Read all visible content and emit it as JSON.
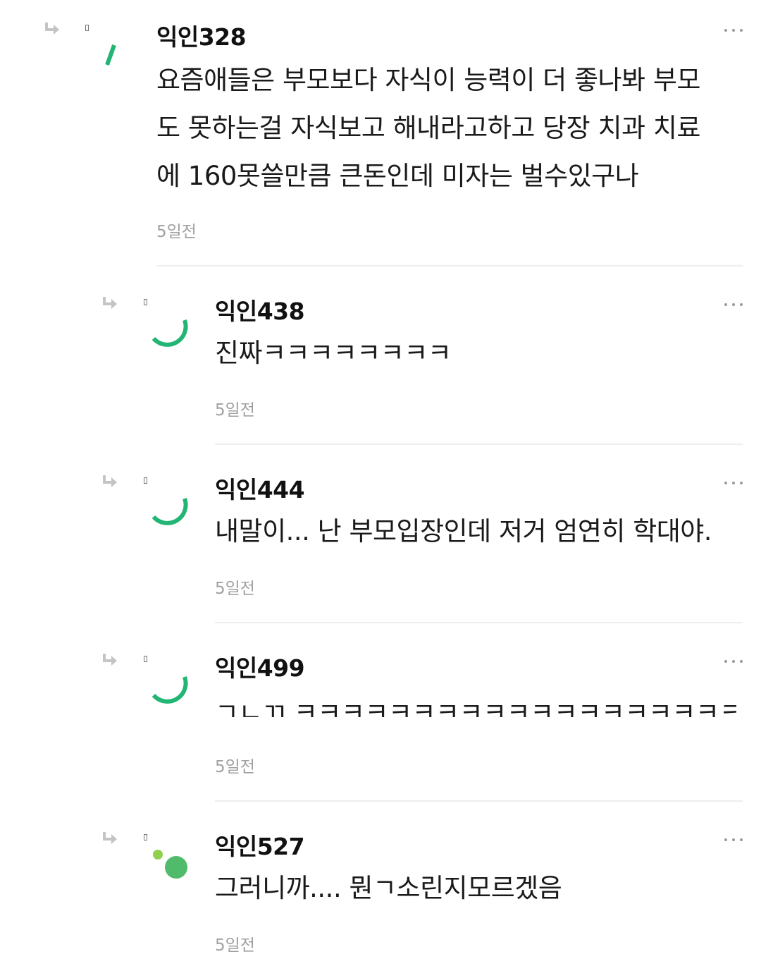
{
  "comments": [
    {
      "nickname": "익인328",
      "text": "요즘애들은 부모보다 자식이 능력이 더 좋나봐 부모도 못하는걸 자식보고 해내라고하고 당장 치과 치료에 160못쓸만큼 큰돈인데 미자는 벌수있구나",
      "lines": [
        "요즘애들은 부모보다 자식이 능력이 더 좋나봐 부모",
        "도 못하는걸 자식보고 해내라고하고 당장 치과 치료",
        "에 160못쓸만큼 큰돈인데 미자는 벌수있구나"
      ],
      "time": "5일전"
    },
    {
      "nickname": "익인438",
      "text": "진짜ㅋㅋㅋㅋㅋㅋㅋㅋ",
      "time": "5일전"
    },
    {
      "nickname": "익인444",
      "text": "내말이... 난 부모입장인데 저거 엄연히 학대야.",
      "time": "5일전"
    },
    {
      "nickname": "익인499",
      "text": "ㄱㄴㄲ ㅋㅋㅋㅋㅋㅋㅋㅋㅋㅋㅋㅋㅋㅋㅋㅋㅋㅋㅋㅋㅋ",
      "time": "5일전"
    },
    {
      "nickname": "익인527",
      "text": "그러니까.... 뭔ㄱ소린지모르겠음",
      "time": "5일전"
    }
  ],
  "icons": {
    "reply": "reply-arrow-icon",
    "more": "more-options-icon",
    "avatar_spinner": "loading-avatar-icon",
    "avatar_dots": "avatar-dots-icon"
  },
  "colors": {
    "accent_green": "#22b573",
    "dot_lime": "#8fd14f",
    "dot_green": "#4fbb6b",
    "time_gray": "#a0a0a0",
    "divider": "#eeeeee"
  }
}
